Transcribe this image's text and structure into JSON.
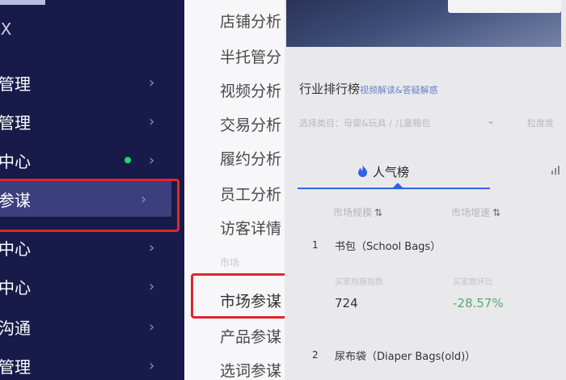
{
  "sidebar": {
    "top_glyph": "Ⅸ",
    "items": [
      {
        "label": "管理",
        "dot": false
      },
      {
        "label": "管理",
        "dot": false
      },
      {
        "label": "中心",
        "dot": true
      },
      {
        "label": "参谋",
        "dot": false,
        "active": true
      },
      {
        "label": "中心",
        "dot": false
      },
      {
        "label": "中心",
        "dot": false
      },
      {
        "label": "沟通",
        "dot": false
      },
      {
        "label": "管理",
        "dot": false
      }
    ],
    "chevron": "›",
    "status_dot_color": "#22d66b"
  },
  "submenu": {
    "items": [
      {
        "label": "店铺分析"
      },
      {
        "label": "半托管分"
      },
      {
        "label": "视频分析"
      },
      {
        "label": "交易分析"
      },
      {
        "label": "履约分析"
      },
      {
        "label": "员工分析"
      },
      {
        "label": "访客详情"
      },
      {
        "label": "市场参谋"
      },
      {
        "label": "产品参谋"
      },
      {
        "label": "选词参谋"
      }
    ],
    "group_label": "市场"
  },
  "content": {
    "title": "行业排行榜",
    "title_link": "视频解读&答疑解惑",
    "filter": {
      "label": "选择类目：母婴&玩具 / 儿童箱包",
      "option": "粒度度"
    },
    "tabs": {
      "popular": "人气榜",
      "popular_icon": "flame-icon"
    },
    "columns": {
      "market_size": "市场规模",
      "market_growth": "市场增速",
      "sort_glyph": "⇅"
    },
    "rows": [
      {
        "rank": "1",
        "name": "书包（School Bags）",
        "metric1_label": "买家规模指数",
        "metric1_value": "724",
        "metric2_label": "买家数环比",
        "metric2_value": "-28.57%"
      },
      {
        "rank": "2",
        "name": "尿布袋（Diaper Bags(old)）"
      }
    ],
    "colors": {
      "accent": "#2f62e6",
      "growth_negative_shown": "#5aa86a",
      "highlight_box": "#e0262d"
    }
  }
}
